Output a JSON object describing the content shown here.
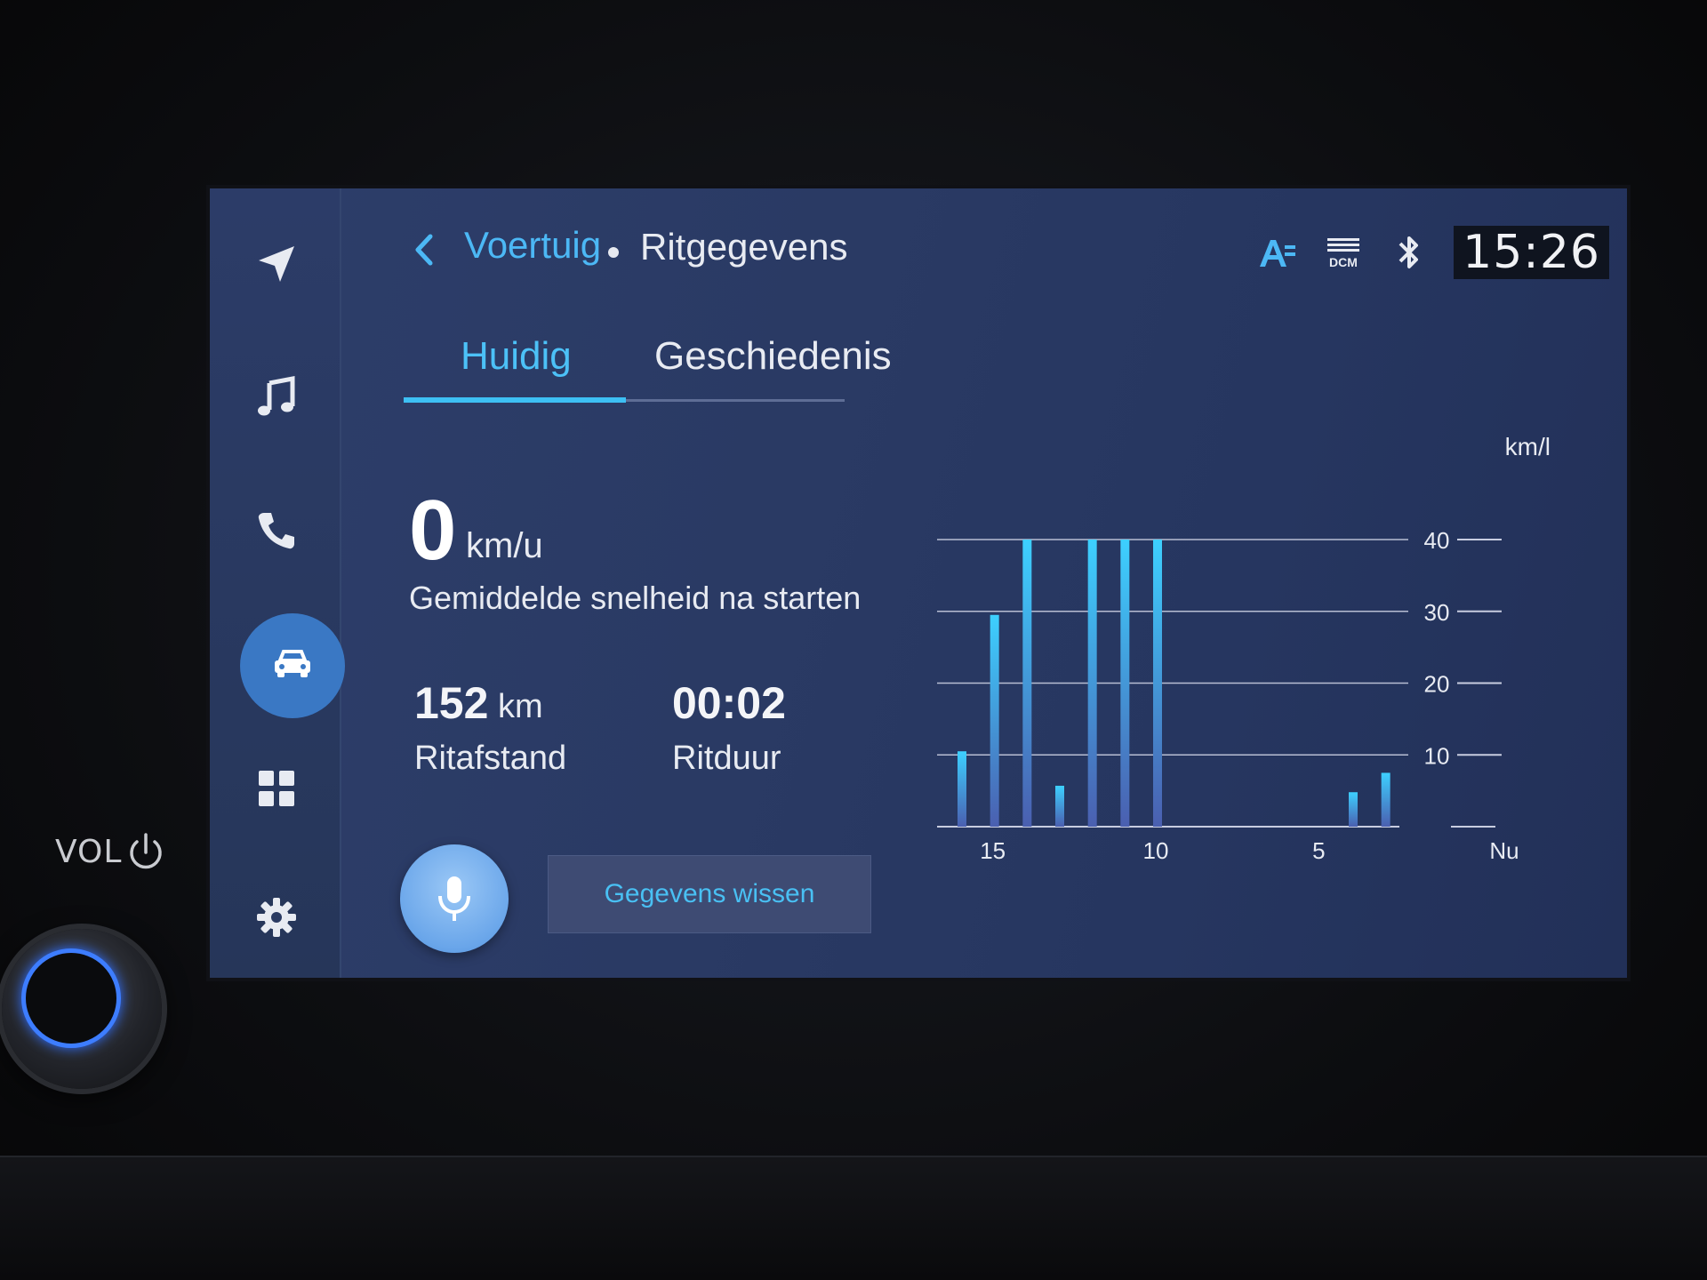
{
  "bezel": {
    "vol_label": "VOL"
  },
  "sidebar": {
    "items": [
      {
        "name": "navigation",
        "icon": "navigation-arrow-icon"
      },
      {
        "name": "media",
        "icon": "music-note-icon"
      },
      {
        "name": "phone",
        "icon": "phone-icon"
      },
      {
        "name": "vehicle",
        "icon": "car-icon",
        "active": true
      },
      {
        "name": "apps",
        "icon": "apps-grid-icon"
      },
      {
        "name": "settings",
        "icon": "gear-icon"
      }
    ]
  },
  "header": {
    "parent": "Voertuig",
    "current": "Ritgegevens",
    "clock": "15:26",
    "status_icons": [
      "text-size-icon",
      "dcm-icon",
      "bluetooth-icon"
    ],
    "dcm_label": "DCM"
  },
  "tabs": [
    {
      "label": "Huidig",
      "active": true
    },
    {
      "label": "Geschiedenis",
      "active": false
    }
  ],
  "stats": {
    "speed_value": "0",
    "speed_unit": "km/u",
    "speed_label": "Gemiddelde snelheid na starten",
    "distance_value": "152",
    "distance_unit": "km",
    "distance_label": "Ritafstand",
    "duration_value": "00:02",
    "duration_label": "Ritduur"
  },
  "actions": {
    "clear_label": "Gegevens wissen"
  },
  "colors": {
    "accent": "#4cc1f7",
    "bar_top": "#3dd0ff",
    "bar_bottom": "#4a5fb0",
    "screen_bg": "#2a3a64"
  },
  "chart_data": {
    "type": "bar",
    "ylabel": "km/l",
    "ylim": [
      0,
      40
    ],
    "yticks": [
      10,
      20,
      30,
      40
    ],
    "x_tick_labels": [
      "15",
      "10",
      "5",
      "Nu"
    ],
    "x": [
      16,
      15,
      14,
      13,
      12,
      11,
      10,
      9,
      8,
      7,
      6,
      5,
      4,
      3,
      2,
      1
    ],
    "values": [
      10.5,
      29.5,
      40,
      5.7,
      40,
      40,
      40,
      0,
      0,
      0,
      0,
      0,
      4.8,
      7.5,
      0,
      0
    ],
    "grid": true
  }
}
